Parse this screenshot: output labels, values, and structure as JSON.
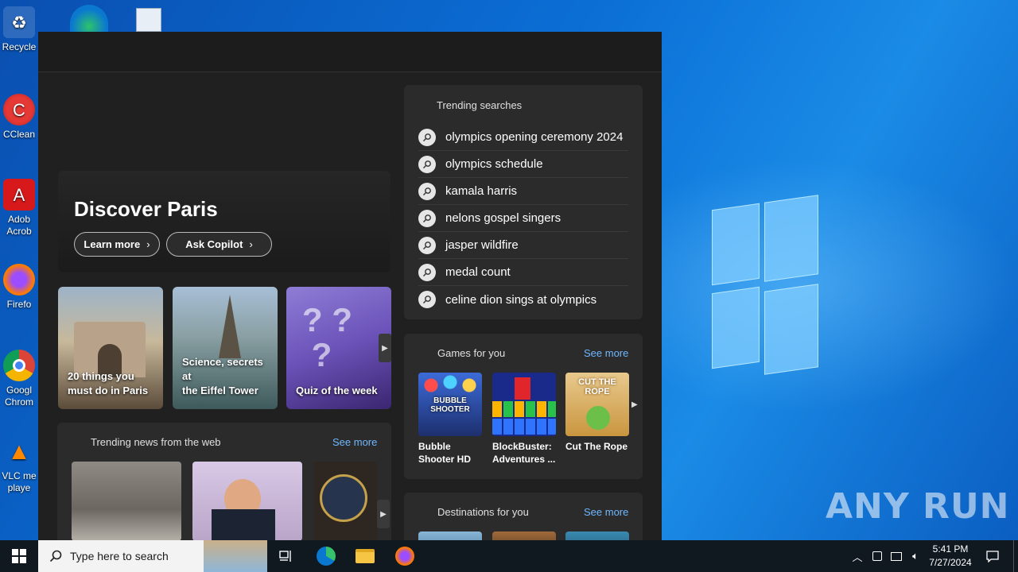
{
  "desktop": {
    "icons": [
      {
        "label": "Recycle",
        "icon": "recycle-bin-icon"
      },
      {
        "label": "CClean",
        "icon": "ccleaner-icon"
      },
      {
        "label": "Adob",
        "label2": "Acrob",
        "icon": "adobe-acrobat-icon"
      },
      {
        "label": "Firefo",
        "icon": "firefox-icon"
      },
      {
        "label": "Googl",
        "label2": "Chrom",
        "icon": "chrome-icon"
      },
      {
        "label": "VLC me",
        "label2": "playe",
        "icon": "vlc-icon"
      }
    ],
    "watermark": "ANY RUN"
  },
  "flyout": {
    "hero": {
      "title": "Discover Paris",
      "learn_more": "Learn more",
      "ask_copilot": "Ask Copilot"
    },
    "tiles": [
      {
        "line1": "20 things you",
        "line2": "must do in Paris"
      },
      {
        "line1": "Science, secrets at",
        "line2": "the Eiffel Tower"
      },
      {
        "line1": "Quiz of the week",
        "line2": ""
      }
    ],
    "news": {
      "title": "Trending news from the web",
      "see_more": "See more"
    },
    "trending": {
      "title": "Trending searches",
      "items": [
        "olympics opening ceremony 2024",
        "olympics schedule",
        "kamala harris",
        "nelons gospel singers",
        "jasper wildfire",
        "medal count",
        "celine dion sings at olympics"
      ]
    },
    "games": {
      "title": "Games for you",
      "see_more": "See more",
      "items": [
        {
          "line1": "Bubble",
          "line2": "Shooter HD",
          "art_text": "BUBBLE SHOOTER"
        },
        {
          "line1": "BlockBuster:",
          "line2": "Adventures ...",
          "art_text": ""
        },
        {
          "line1": "Cut The Rope",
          "line2": "",
          "art_text": "CUT THE ROPE"
        }
      ]
    },
    "destinations": {
      "title": "Destinations for you",
      "see_more": "See more"
    }
  },
  "taskbar": {
    "search_placeholder": "Type here to search",
    "time": "5:41 PM",
    "date": "7/27/2024"
  }
}
